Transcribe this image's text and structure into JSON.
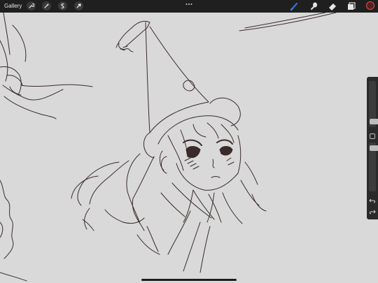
{
  "toolbar": {
    "gallery_label": "Gallery",
    "left_tools": [
      "wrench-icon",
      "magic-wand-icon",
      "selection-icon",
      "transform-arrow-icon"
    ],
    "more_icon": "ellipsis-icon",
    "right_tools": [
      "brush-icon",
      "smudge-icon",
      "eraser-icon",
      "layers-icon"
    ],
    "accent_color": "#3d7be0",
    "current_color": "#5a1e1e"
  },
  "sidebar": {
    "brush_size_level": 0.7,
    "opacity_level": 0.8,
    "icons": [
      "modify-square-icon",
      "undo-icon",
      "redo-icon"
    ]
  },
  "canvas": {
    "background_color": "#d9d9d9",
    "ink_color": "#3b2a2a"
  }
}
